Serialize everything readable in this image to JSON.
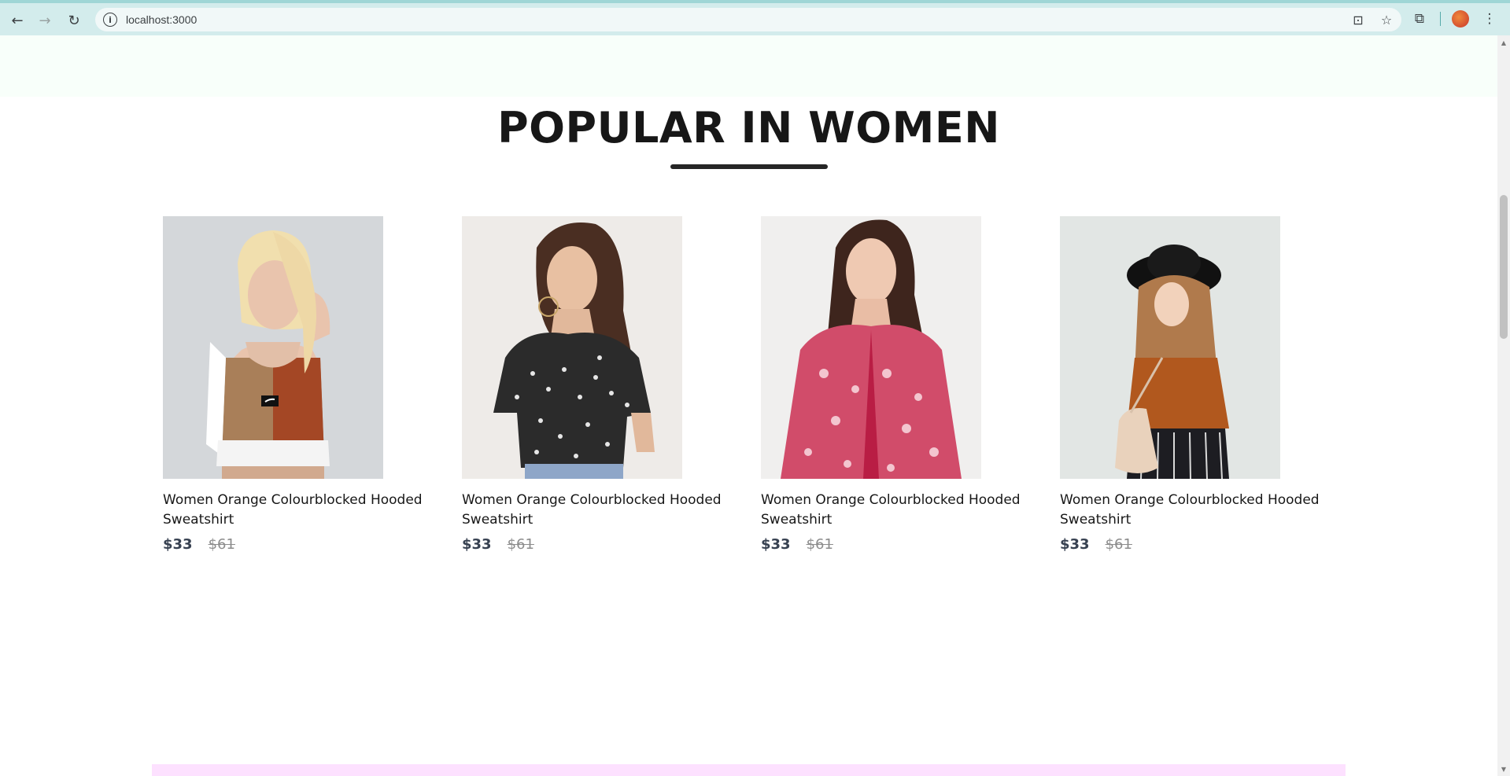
{
  "browser": {
    "url": "localhost:3000",
    "back_icon": "←",
    "forward_icon": "→",
    "reload_icon": "↻",
    "site_info_icon": "i",
    "install_icon": "⊡",
    "bookmark_icon": "☆",
    "extensions_icon": "⧉",
    "menu_icon": "⋮"
  },
  "section": {
    "title": "POPULAR IN WOMEN"
  },
  "products": [
    {
      "name": "Women Orange Colourblocked Hooded Sweatshirt",
      "new_price": "$33",
      "old_price": "$61"
    },
    {
      "name": "Women Orange Colourblocked Hooded Sweatshirt",
      "new_price": "$33",
      "old_price": "$61"
    },
    {
      "name": "Women Orange Colourblocked Hooded Sweatshirt",
      "new_price": "$33",
      "old_price": "$61"
    },
    {
      "name": "Women Orange Colourblocked Hooded Sweatshirt",
      "new_price": "$33",
      "old_price": "$61"
    }
  ],
  "colors": {
    "chrome_bg": "#d3ecec",
    "hero_bg": "#f8fffa",
    "title": "#171717",
    "price": "#374151",
    "old_price": "#8c8c8c",
    "offer_bg": "#fde1ff"
  }
}
